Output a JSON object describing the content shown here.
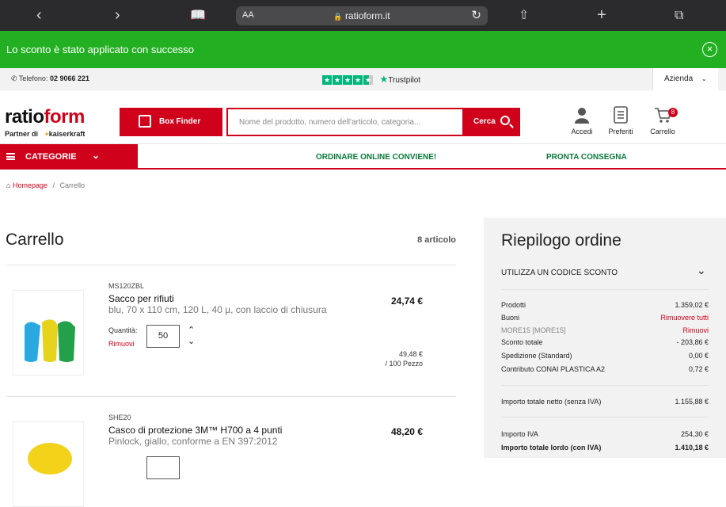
{
  "browser": {
    "text_size": "AA",
    "url": "ratioform.it"
  },
  "banner": {
    "message": "Lo sconto è stato applicato con successo"
  },
  "topbar": {
    "phone_label": "Telefono:",
    "phone": "02 9066 221",
    "trustpilot": "Trustpilot",
    "account_type": "Azienda"
  },
  "header": {
    "logo_black": "ratio",
    "logo_red": "form",
    "partner_prefix": "Partner di",
    "partner_name": "kaiserkraft",
    "box_finder": "Box Finder",
    "search_placeholder": "Nome del prodotto, numero dell'articolo, categoria...",
    "search_button": "Cerca",
    "accedi": "Accedi",
    "preferiti": "Preferiti",
    "carrello": "Carrello",
    "cart_badge": "8"
  },
  "nav": {
    "categories": "CATEGORIE",
    "link1": "ORDINARE ONLINE CONVIENE!",
    "link2": "PRONTA CONSEGNA"
  },
  "breadcrumb": {
    "home": "Homepage",
    "separator": "/",
    "current": "Carrello"
  },
  "cart": {
    "title": "Carrello",
    "count": "8 articolo",
    "items": [
      {
        "sku": "MS120ZBL",
        "name": "Sacco per rifiuti",
        "desc": "blu, 70 x 110 cm, 120 L, 40 µ, con laccio di chiusura",
        "price": "24,74 €",
        "qty_label": "Quantità:",
        "remove": "Rimuovi",
        "qty": "50",
        "unit_price": "49,48 €",
        "unit": "/ 100 Pezzo"
      },
      {
        "sku": "SHE20",
        "name": "Casco di protezione 3M™ H700 a 4 punti",
        "desc": "Pinlock, giallo, conforme a EN 397:2012",
        "price": "48,20 €"
      }
    ]
  },
  "summary": {
    "title": "Riepilogo ordine",
    "coupon": "UTILIZZA UN CODICE SCONTO",
    "rows": [
      {
        "label": "Prodotti",
        "value": "1.359,02 €"
      },
      {
        "label": "Buoni",
        "value": "Rimuovere tutti"
      },
      {
        "label": "MORE15 [MORE15]",
        "value": "Rimuovi"
      },
      {
        "label": "Sconto totale",
        "value": "- 203,86 €"
      },
      {
        "label": "Spedizione (Standard)",
        "value": "0,00 €"
      },
      {
        "label": "Contributo CONAI PLASTICA A2",
        "value": "0,72 €"
      },
      {
        "label": "Importo totale netto (senza IVA)",
        "value": "1.155,88 €"
      },
      {
        "label": "Importo IVA",
        "value": "254,30 €"
      },
      {
        "label": "Importo totale lordo (con IVA)",
        "value": "1.410,18 €"
      }
    ]
  },
  "colors": {
    "brand_red": "#d0021b",
    "success_green": "#22b022",
    "nav_green": "#0a7a3a",
    "trustpilot_green": "#00b67a"
  }
}
